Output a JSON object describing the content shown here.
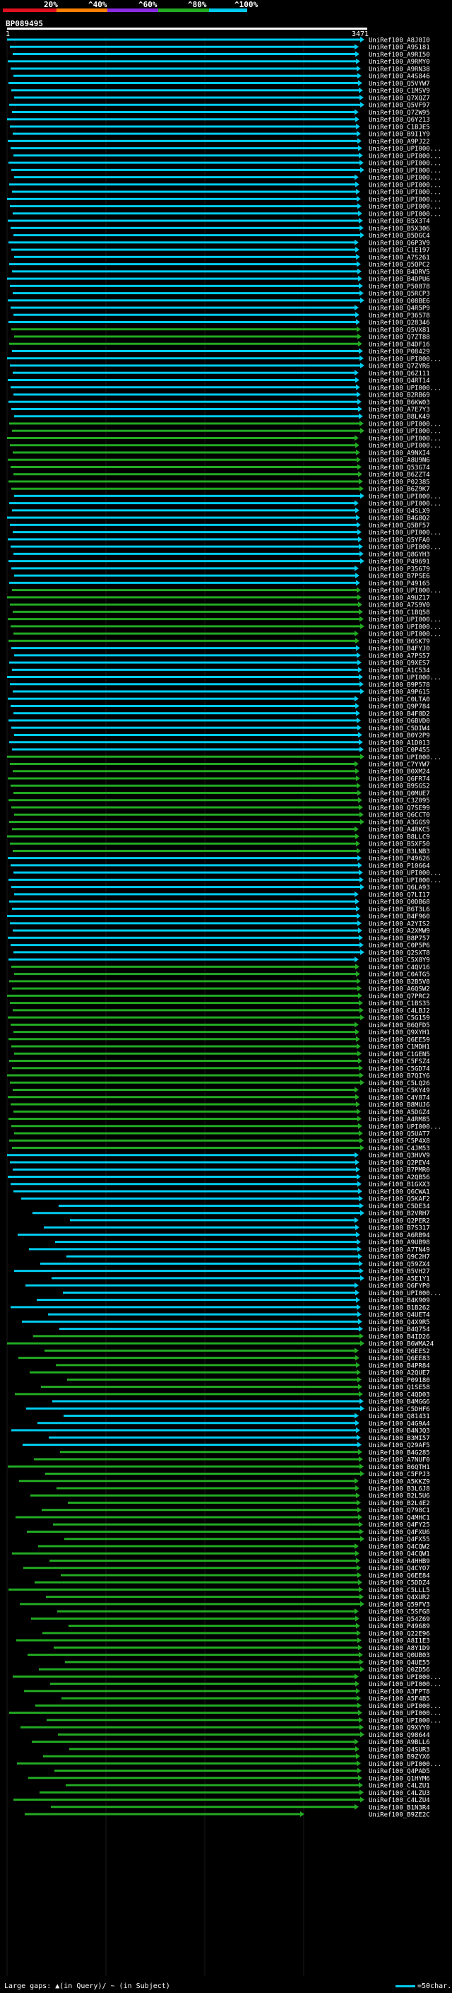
{
  "scale": {
    "labels": [
      "20%",
      "^40%",
      "^60%",
      "^80%",
      "^100%"
    ],
    "colors": [
      "#e0101e",
      "#ff8000",
      "#8a2be2",
      "#22aa22",
      "#00cbee"
    ]
  },
  "query": {
    "id": "BP089495",
    "start": "1",
    "end": "3471"
  },
  "hits": [
    "UniRef100_A8J0I0",
    "UniRef100_A9S181",
    "UniRef100_A9RI50",
    "UniRef100_A9RMY0",
    "UniRef100_A9RN38",
    "UniRef100_A4S846",
    "UniRef100_Q5VYW7",
    "UniRef100_C1MSV9",
    "UniRef100_Q7XQZ7",
    "UniRef100_Q5VF97",
    "UniRef100_Q7ZW95",
    "UniRef100_Q6Y213",
    "UniRef100_C1BJE5",
    "UniRef100_B9I1Y9",
    "UniRef100_A9PJ22",
    "UniRef100_UPI000...",
    "UniRef100_UPI000...",
    "UniRef100_UPI000...",
    "UniRef100_UPI000...",
    "UniRef100_UPI000...",
    "UniRef100_UPI000...",
    "UniRef100_UPI000...",
    "UniRef100_UPI000...",
    "UniRef100_UPI000...",
    "UniRef100_UPI000...",
    "UniRef100_B5X3T4",
    "UniRef100_B5X306",
    "UniRef100_B5DGC4",
    "UniRef100_Q6P3V9",
    "UniRef100_C1E197",
    "UniRef100_A7S261",
    "UniRef100_Q5QPC2",
    "UniRef100_B4DRV5",
    "UniRef100_B4DPU6",
    "UniRef100_P50878",
    "UniRef100_Q5RCP3",
    "UniRef100_Q08BE6",
    "UniRef100_Q4R5P9",
    "UniRef100_P36578",
    "UniRef100_Q28346",
    "UniRef100_Q5VX81",
    "UniRef100_Q7ZT88",
    "UniRef100_B4DF16",
    "UniRef100_P08429",
    "UniRef100_UPI000...",
    "UniRef100_Q7ZYR6",
    "UniRef100_Q6Z111",
    "UniRef100_Q4RT14",
    "UniRef100_UPI000...",
    "UniRef100_B2RB69",
    "UniRef100_B6KW03",
    "UniRef100_A7E7Y3",
    "UniRef100_B8LK49",
    "UniRef100_UPI000...",
    "UniRef100_UPI000...",
    "UniRef100_UPI000...",
    "UniRef100_UPI000...",
    "UniRef100_A9NXI4",
    "UniRef100_A8U9N6",
    "UniRef100_Q53G74",
    "UniRef100_B6ZZT4",
    "UniRef100_P02385",
    "UniRef100_B6Z9K7",
    "UniRef100_UPI000...",
    "UniRef100_UPI000...",
    "UniRef100_Q4SLX9",
    "UniRef100_B4G8Q2",
    "UniRef100_Q5BF57",
    "UniRef100_UPI000...",
    "UniRef100_Q5YFA0",
    "UniRef100_UPI000...",
    "UniRef100_Q8GYH3",
    "UniRef100_P49691",
    "UniRef100_P35679",
    "UniRef100_B7PSE6",
    "UniRef100_P49165",
    "UniRef100_UPI000...",
    "UniRef100_A9UZ17",
    "UniRef100_A7S9V0",
    "UniRef100_C1BQ58",
    "UniRef100_UPI000...",
    "UniRef100_UPI000...",
    "UniRef100_UPI000...",
    "UniRef100_B6SK79",
    "UniRef100_B4FYJ0",
    "UniRef100_A7PS57",
    "UniRef100_Q9XES7",
    "UniRef100_A1C534",
    "UniRef100_UPI000...",
    "UniRef100_B9P578",
    "UniRef100_A9P615",
    "UniRef100_C0LTA0",
    "UniRef100_Q9P784",
    "UniRef100_B4F8D2",
    "UniRef100_Q6BVD0",
    "UniRef100_C5DIW4",
    "UniRef100_B0Y2P9",
    "UniRef100_A1D013",
    "UniRef100_C0P455",
    "UniRef100_UPI000...",
    "UniRef100_C7YYW7",
    "UniRef100_B0XM24",
    "UniRef100_Q6FR74",
    "UniRef100_B9SGS2",
    "UniRef100_Q0MUE7",
    "UniRef100_C3Z095",
    "UniRef100_Q7SE99",
    "UniRef100_Q6CCT0",
    "UniRef100_A3GGS9",
    "UniRef100_A4RKC5",
    "UniRef100_B8LLC9",
    "UniRef100_B5XF50",
    "UniRef100_B3LNB3",
    "UniRef100_P49626",
    "UniRef100_P10664",
    "UniRef100_UPI000...",
    "UniRef100_UPI000...",
    "UniRef100_Q6LA93",
    "UniRef100_Q7LI17",
    "UniRef100_Q0DB68",
    "UniRef100_B6T3L6",
    "UniRef100_B4F960",
    "UniRef100_A2YIS2",
    "UniRef100_A2XMW9",
    "UniRef100_B8P757",
    "UniRef100_C0P5P6",
    "UniRef100_Q2SXT8",
    "UniRef100_C5X8Y9",
    "UniRef100_C4QV16",
    "UniRef100_C0ATG5",
    "UniRef100_B2B5V8",
    "UniRef100_A6QSW2",
    "UniRef100_Q7PRC2",
    "UniRef100_C1BS35",
    "UniRef100_C4LBJ2",
    "UniRef100_C5G159",
    "UniRef100_B6QFD5",
    "UniRef100_Q9XYH1",
    "UniRef100_Q6EE59",
    "UniRef100_C1MDH1",
    "UniRef100_C1GEN5",
    "UniRef100_C5FSZ4",
    "UniRef100_C5GD74",
    "UniRef100_B7QIY6",
    "UniRef100_C5LQ26",
    "UniRef100_C5KY49",
    "UniRef100_C4Y874",
    "UniRef100_B8MUJ6",
    "UniRef100_A5DGZ4",
    "UniRef100_A4RM85",
    "UniRef100_UPI000...",
    "UniRef100_Q5UAT7",
    "UniRef100_C5P4X8",
    "UniRef100_C4JM53",
    "UniRef100_Q3HVV9",
    "UniRef100_Q2PEV4",
    "UniRef100_B7PMR0",
    "UniRef100_A2QB56",
    "UniRef100_B1GXX3",
    "UniRef100_Q6CWA1",
    "UniRef100_Q5KAF2",
    "UniRef100_C5DE34",
    "UniRef100_B2VRH7",
    "UniRef100_Q2PER2",
    "UniRef100_B7S317",
    "UniRef100_A6RB94",
    "UniRef100_A9UB98",
    "UniRef100_A7TN49",
    "UniRef100_Q9C2H7",
    "UniRef100_Q59ZX4",
    "UniRef100_B5VH27",
    "UniRef100_A5E1Y1",
    "UniRef100_Q6FYP0",
    "UniRef100_UPI000...",
    "UniRef100_B4K909",
    "UniRef100_B1B262",
    "UniRef100_Q4UET4",
    "UniRef100_Q4X9R5",
    "UniRef100_B4Q754",
    "UniRef100_B4ID26",
    "UniRef100_B6WMA24",
    "UniRef100_Q6EES2",
    "UniRef100_Q6EE83",
    "UniRef100_B4PR84",
    "UniRef100_A2QUE7",
    "UniRef100_P09180",
    "UniRef100_Q1SE58",
    "UniRef100_C4QD03",
    "UniRef100_B4MGG6",
    "UniRef100_C5DHF6",
    "UniRef100_Q81431",
    "UniRef100_Q4G9A4",
    "UniRef100_B4NJQ3",
    "UniRef100_B3MI57",
    "UniRef100_Q29AF5",
    "UniRef100_B4G285",
    "UniRef100_A7NUF0",
    "UniRef100_B6QTH1",
    "UniRef100_C5FPJ3",
    "UniRef100_A5KKZ9",
    "UniRef100_B3L6J8",
    "UniRef100_B2L5U6",
    "UniRef100_B2L4E2",
    "UniRef100_Q798C1",
    "UniRef100_Q4MHC1",
    "UniRef100_Q4FY25",
    "UniRef100_Q4FXU6",
    "UniRef100_Q4FX55",
    "UniRef100_Q4CQW2",
    "UniRef100_Q4CQW1",
    "UniRef100_A4HHB9",
    "UniRef100_Q4CYO7",
    "UniRef100_Q6EE84",
    "UniRef100_C5DDZ4",
    "UniRef100_C5LLL5",
    "UniRef100_Q4XUR2",
    "UniRef100_Q59FV3",
    "UniRef100_C5SFG8",
    "UniRef100_Q54Z69",
    "UniRef100_P49689",
    "UniRef100_Q22E96",
    "UniRef100_A8I1E3",
    "UniRef100_A8Y1D9",
    "UniRef100_Q0UB03",
    "UniRef100_Q4UE55",
    "UniRef100_Q0ZD56",
    "UniRef100_UPI000...",
    "UniRef100_UPI000...",
    "UniRef100_A3FPT8",
    "UniRef100_A5F4B5",
    "UniRef100_UPI000...",
    "UniRef100_UPI000...",
    "UniRef100_UPI000...",
    "UniRef100_Q9XYY0",
    "UniRef100_Q98644",
    "UniRef100_A9BLL6",
    "UniRef100_Q4SUR3",
    "UniRef100_B9ZYX6",
    "UniRef100_UPI000...",
    "UniRef100_Q4PAD5",
    "UniRef100_Q1HYM6",
    "UniRef100_C4LZU1",
    "UniRef100_C4LZU3",
    "UniRef100_C4LZU4",
    "UniRef100_B1N3R4",
    "UniRef100_B9ZE2C"
  ],
  "footer": {
    "left": "Large gaps: ▲(in Query)/ ~ (in Subject)",
    "right": "=50char."
  }
}
